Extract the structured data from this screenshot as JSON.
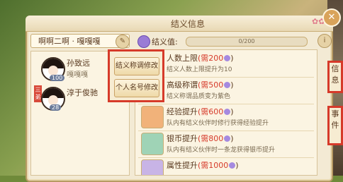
{
  "window": {
    "title": "结义信息",
    "close_label": "✕"
  },
  "group": {
    "name": "啊啊二啊 · 嘎嘎嘎"
  },
  "members": [
    {
      "name": "孙致远",
      "title": "嘎嘎嘎",
      "level": "100",
      "tag": ""
    },
    {
      "name": "淳于俊驰",
      "title": "",
      "level": "28",
      "tag": "三弟"
    }
  ],
  "popup": {
    "btn1": "结义称调修改",
    "btn2": "个人名号修改"
  },
  "value": {
    "label": "结义值:",
    "progress": "0/200"
  },
  "info_label": "i",
  "upgrades": [
    {
      "title": "人数上限",
      "cost": "(需200",
      "desc": "结义人数上限提升为10",
      "color": "purple"
    },
    {
      "title": "高级称谓",
      "cost": "(需500",
      "desc": "结义称谓品质变为紫色",
      "color": "purple"
    },
    {
      "title": "经验提升",
      "cost": "(需600",
      "desc": "队内有结义伙伴时修行获得经验提升",
      "color": "orange"
    },
    {
      "title": "银币提升",
      "cost": "(需800",
      "desc": "队内有结义伙伴时一条龙获得银币提升",
      "color": "green"
    },
    {
      "title": "属性提升",
      "cost": "(需1000",
      "desc": "",
      "color": "purple"
    }
  ],
  "side": {
    "box1": "信息",
    "box2": "事件"
  }
}
